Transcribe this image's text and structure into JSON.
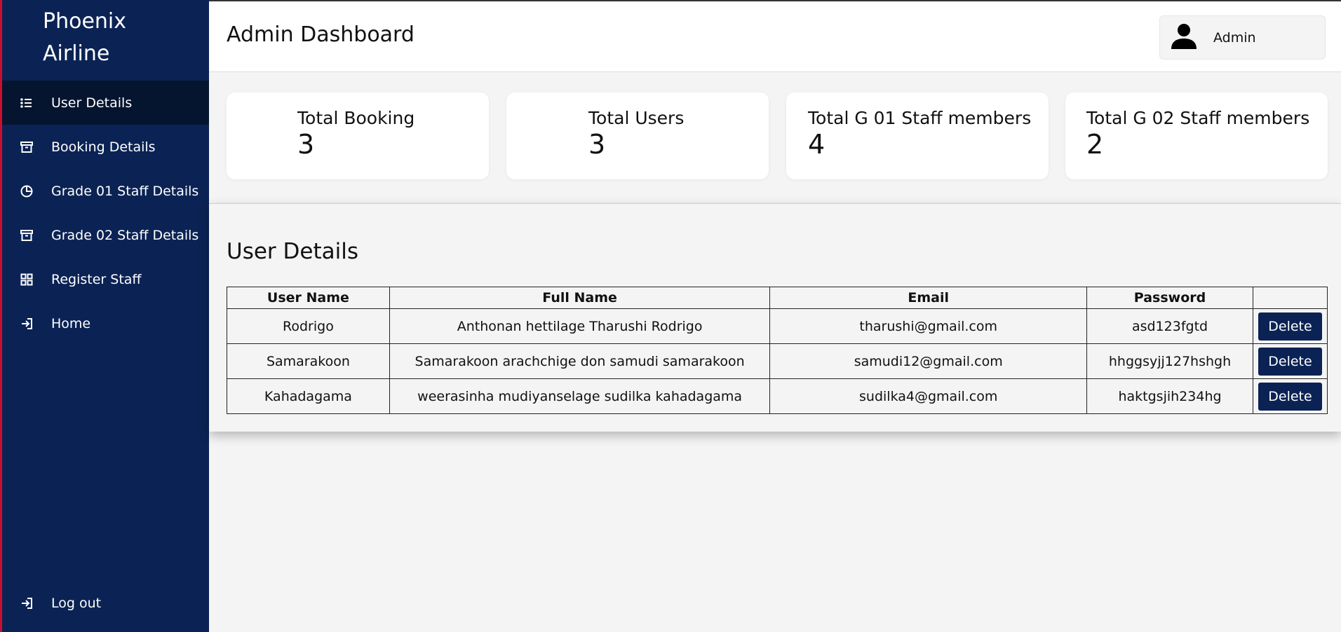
{
  "brand": {
    "line1": "Phoenix",
    "line2": "Airline"
  },
  "sidebar": {
    "items": [
      {
        "label": "User Details",
        "icon": "list-icon",
        "active": true
      },
      {
        "label": "Booking Details",
        "icon": "archive-icon"
      },
      {
        "label": "Grade 01 Staff Details",
        "icon": "pie-chart-icon"
      },
      {
        "label": "Grade 02 Staff Details",
        "icon": "archive-icon"
      },
      {
        "label": "Register Staff",
        "icon": "grid-icon"
      },
      {
        "label": "Home",
        "icon": "sign-in-icon"
      }
    ],
    "logout": {
      "label": "Log out",
      "icon": "sign-in-icon"
    }
  },
  "header": {
    "title": "Admin Dashboard",
    "user": "Admin"
  },
  "stats": [
    {
      "label": "Total Booking",
      "value": "3"
    },
    {
      "label": "Total Users",
      "value": "3"
    },
    {
      "label": "Total G 01 Staff members",
      "value": "4"
    },
    {
      "label": "Total G 02 Staff members",
      "value": "2"
    }
  ],
  "users_section": {
    "title": "User Details",
    "columns": [
      "User Name",
      "Full Name",
      "Email",
      "Password",
      ""
    ],
    "rows": [
      {
        "username": "Rodrigo",
        "fullname": "Anthonan hettilage Tharushi Rodrigo",
        "email": "tharushi@gmail.com",
        "password": "asd123fgtd",
        "action": "Delete"
      },
      {
        "username": "Samarakoon",
        "fullname": "Samarakoon arachchige don samudi samarakoon",
        "email": "samudi12@gmail.com",
        "password": "hhggsyjj127hshgh",
        "action": "Delete"
      },
      {
        "username": "Kahadagama",
        "fullname": "weerasinha mudiyanselage sudilka kahadagama",
        "email": "sudilka4@gmail.com",
        "password": "haktgsjih234hg",
        "action": "Delete"
      }
    ]
  },
  "colors": {
    "sidebar": "#0b2354",
    "active_item": "#06152f",
    "accent_edge": "#c8102e",
    "button": "#0b2354"
  }
}
